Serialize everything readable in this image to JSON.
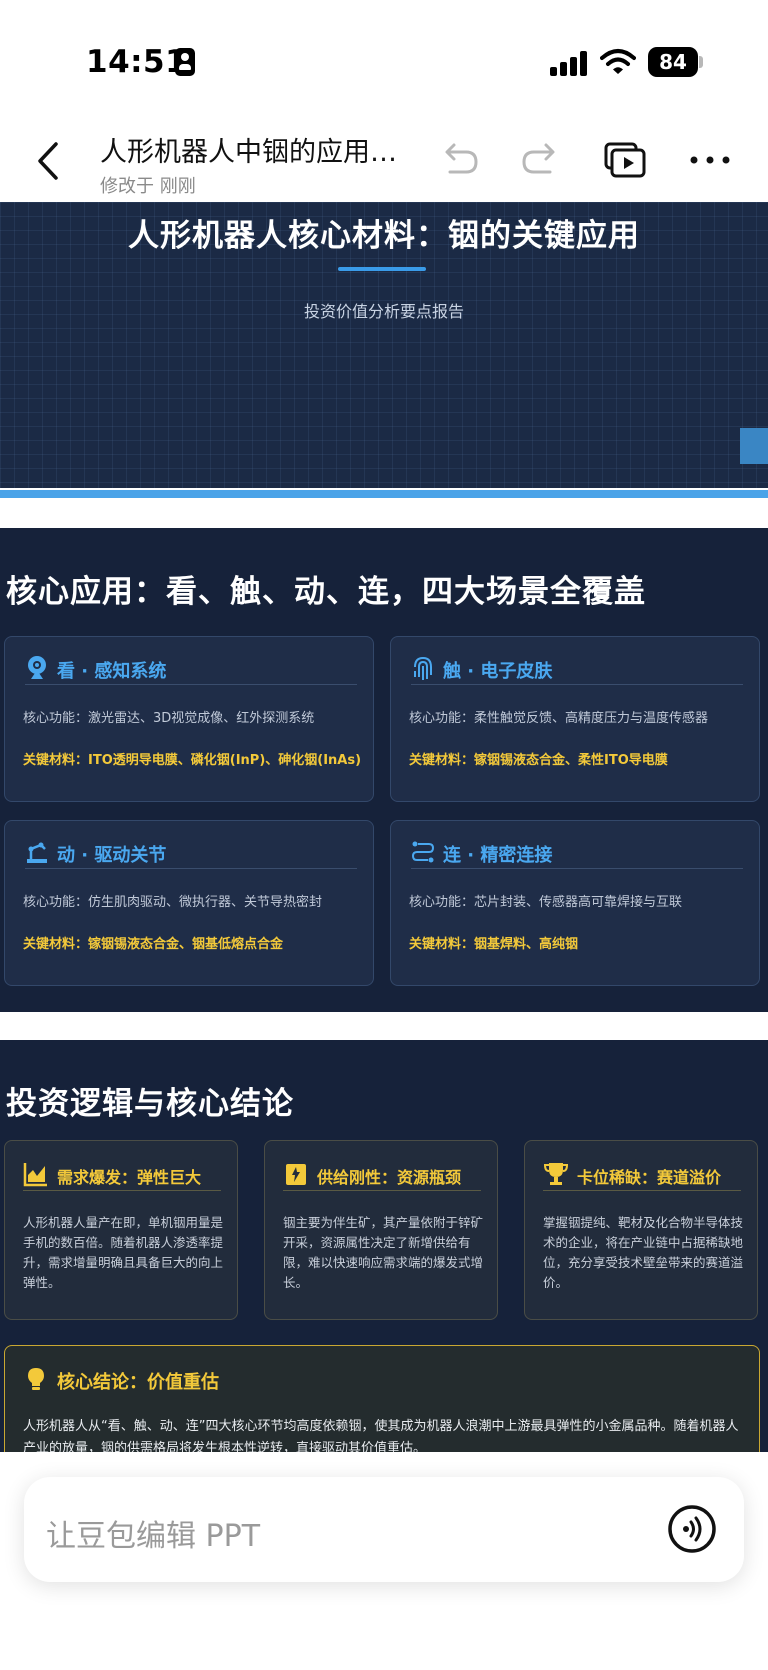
{
  "status_bar": {
    "time": "14:51",
    "battery": "84"
  },
  "nav": {
    "title": "人形机器人中铟的应用…",
    "subtitle": "修改于 刚刚"
  },
  "slide1": {
    "title": "人形机器人核心材料：铟的关键应用",
    "subtitle": "投资价值分析要点报告"
  },
  "slide2": {
    "title": "核心应用：看、触、动、连，四大场景全覆盖",
    "cards": [
      {
        "icon": "webcam-icon",
        "title": "看 · 感知系统",
        "function": "核心功能：激光雷达、3D视觉成像、红外探测系统",
        "materials": "关键材料：ITO透明导电膜、磷化铟(InP)、砷化铟(InAs)"
      },
      {
        "icon": "fingerprint-icon",
        "title": "触 · 电子皮肤",
        "function": "核心功能：柔性触觉反馈、高精度压力与温度传感器",
        "materials": "关键材料：镓铟锡液态合金、柔性ITO导电膜"
      },
      {
        "icon": "robot-arm-icon",
        "title": "动 · 驱动关节",
        "function": "核心功能：仿生肌肉驱动、微执行器、关节导热密封",
        "materials": "关键材料：镓铟锡液态合金、铟基低熔点合金"
      },
      {
        "icon": "route-icon",
        "title": "连 · 精密连接",
        "function": "核心功能：芯片封装、传感器高可靠焊接与互联",
        "materials": "关键材料：铟基焊料、高纯铟"
      }
    ]
  },
  "slide3": {
    "title": "投资逻辑与核心结论",
    "logic": [
      {
        "icon": "chart-area-icon",
        "title": "需求爆发：弹性巨大",
        "body": "人形机器人量产在即，单机铟用量是手机的数百倍。随着机器人渗透率提升，需求增量明确且具备巨大的向上弹性。"
      },
      {
        "icon": "mine-icon",
        "title": "供给刚性：资源瓶颈",
        "body": "铟主要为伴生矿，其产量依附于锌矿开采，资源属性决定了新增供给有限，难以快速响应需求端的爆发式增长。"
      },
      {
        "icon": "trophy-icon",
        "title": "卡位稀缺：赛道溢价",
        "body": "掌握铟提纯、靶材及化合物半导体技术的企业，将在产业链中占据稀缺地位，充分享受技术壁垒带来的赛道溢价。"
      }
    ],
    "conclusion": {
      "icon": "lightbulb-icon",
      "title": "核心结论：价值重估",
      "body": "人形机器人从“看、触、动、连”四大核心环节均高度依赖铟，使其成为机器人浪潮中上游最具弹性的小金属品种。随着机器人产业的放量，铟的供需格局将发生根本性逆转，直接驱动其价值重估。"
    }
  },
  "bottom": {
    "input_placeholder": "让豆包编辑 PPT"
  },
  "colors": {
    "accent_blue": "#4aa8f0",
    "accent_gold": "#f3c93a",
    "slide_bg": "#16223a"
  }
}
